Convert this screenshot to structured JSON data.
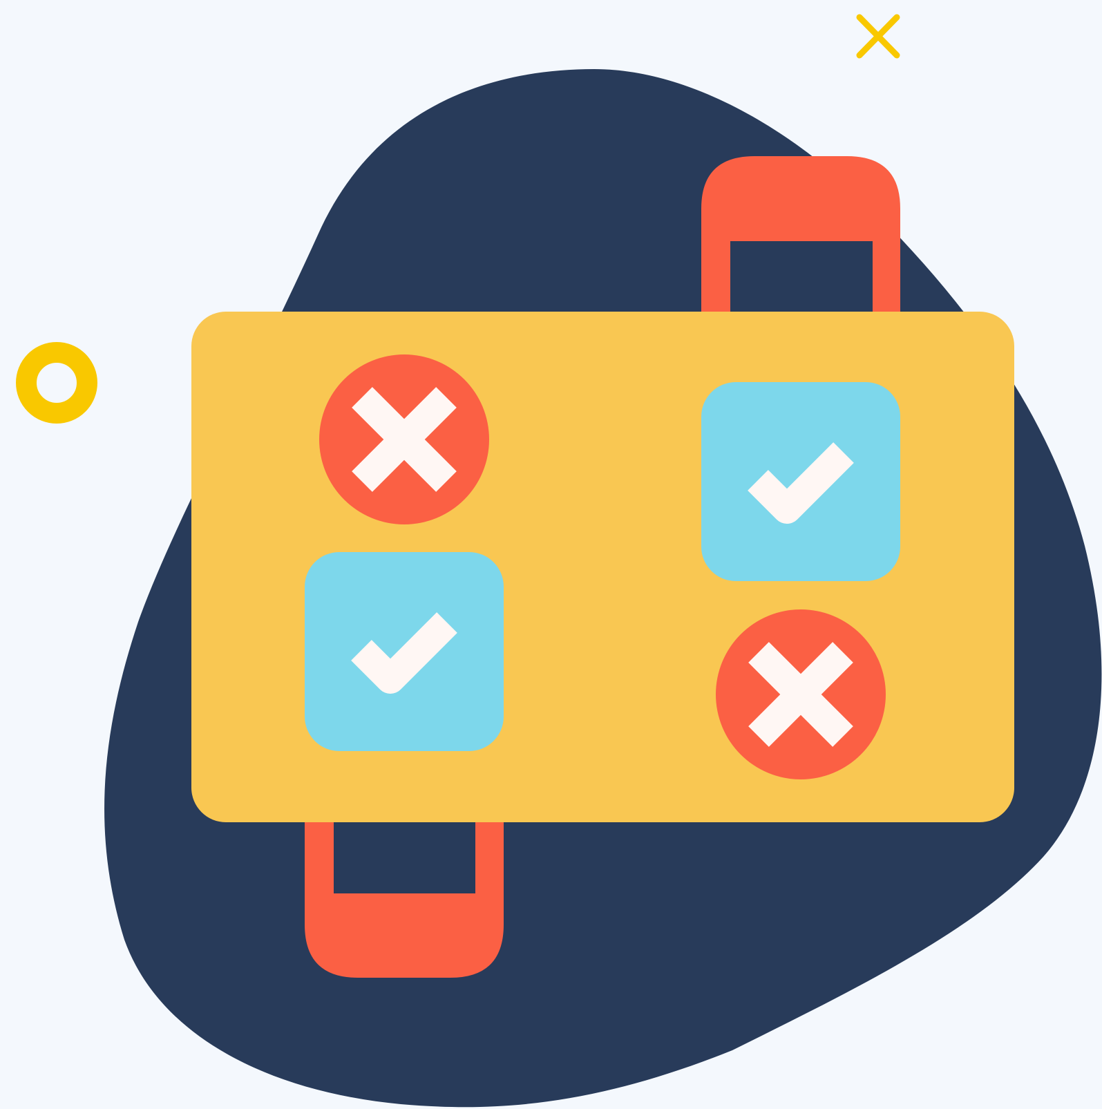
{
  "colors": {
    "background": "#f4f8fd",
    "blob": "#283b5a",
    "board": "#f9c752",
    "handle": "#fb6044",
    "wrong_badge": "#fb6044",
    "correct_badge": "#7dd7eb",
    "mark": "#fff7f4",
    "accent": "#f9c800"
  },
  "board": {
    "items": [
      {
        "status": "incorrect",
        "shape": "circle",
        "icon": "x-mark-icon"
      },
      {
        "status": "correct",
        "shape": "rounded-square",
        "icon": "checkmark-icon"
      },
      {
        "status": "correct",
        "shape": "rounded-square",
        "icon": "checkmark-icon"
      },
      {
        "status": "incorrect",
        "shape": "circle",
        "icon": "x-mark-icon"
      }
    ]
  },
  "decorations": [
    "ring-icon",
    "sparkle-x-icon"
  ]
}
